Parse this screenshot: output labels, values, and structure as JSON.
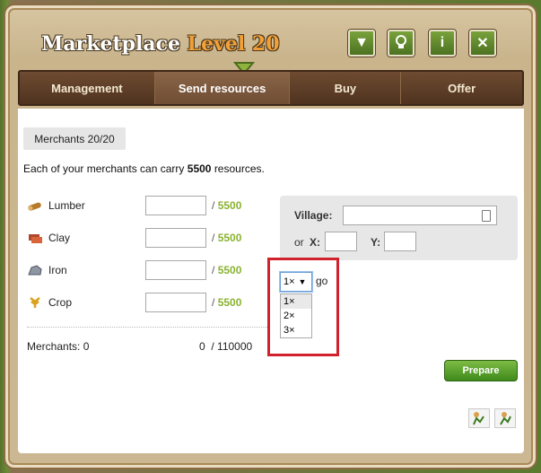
{
  "window": {
    "title": "Marketplace",
    "level": "Level 20"
  },
  "title_buttons": [
    {
      "icon": "chevron-down-icon",
      "glyph": "▼"
    },
    {
      "icon": "lightbulb-icon",
      "glyph": "💡"
    },
    {
      "icon": "info-icon",
      "glyph": "i"
    },
    {
      "icon": "close-icon",
      "glyph": "✕"
    }
  ],
  "tabs": [
    {
      "label": "Management",
      "active": false
    },
    {
      "label": "Send resources",
      "active": true
    },
    {
      "label": "Buy",
      "active": false
    },
    {
      "label": "Offer",
      "active": false
    }
  ],
  "merchants_badge": "Merchants 20/20",
  "carry_text": {
    "prefix": "Each of your merchants can carry",
    "amount": "5500",
    "suffix": "resources."
  },
  "resources": [
    {
      "name": "Lumber",
      "icon": "lumber-icon",
      "value": "",
      "max": "5500"
    },
    {
      "name": "Clay",
      "icon": "clay-icon",
      "value": "",
      "max": "5500"
    },
    {
      "name": "Iron",
      "icon": "iron-icon",
      "value": "",
      "max": "5500"
    },
    {
      "name": "Crop",
      "icon": "crop-icon",
      "value": "",
      "max": "5500"
    }
  ],
  "separator": "/",
  "merchants_summary": {
    "label": "Merchants: 0",
    "sent": "0",
    "total": "110000"
  },
  "village": {
    "village_label": "Village:",
    "village_value": "",
    "or_label": "or",
    "x_label": "X:",
    "y_label": "Y:"
  },
  "repeat": {
    "selected": "1×",
    "options": [
      "1×",
      "2×",
      "3×"
    ],
    "go_label": "go"
  },
  "prepare_label": "Prepare",
  "colors": {
    "accent_green": "#8ab232",
    "title_level": "#f2a037",
    "highlight_red": "#d0212c",
    "tab_brown": "#5b3c26"
  }
}
